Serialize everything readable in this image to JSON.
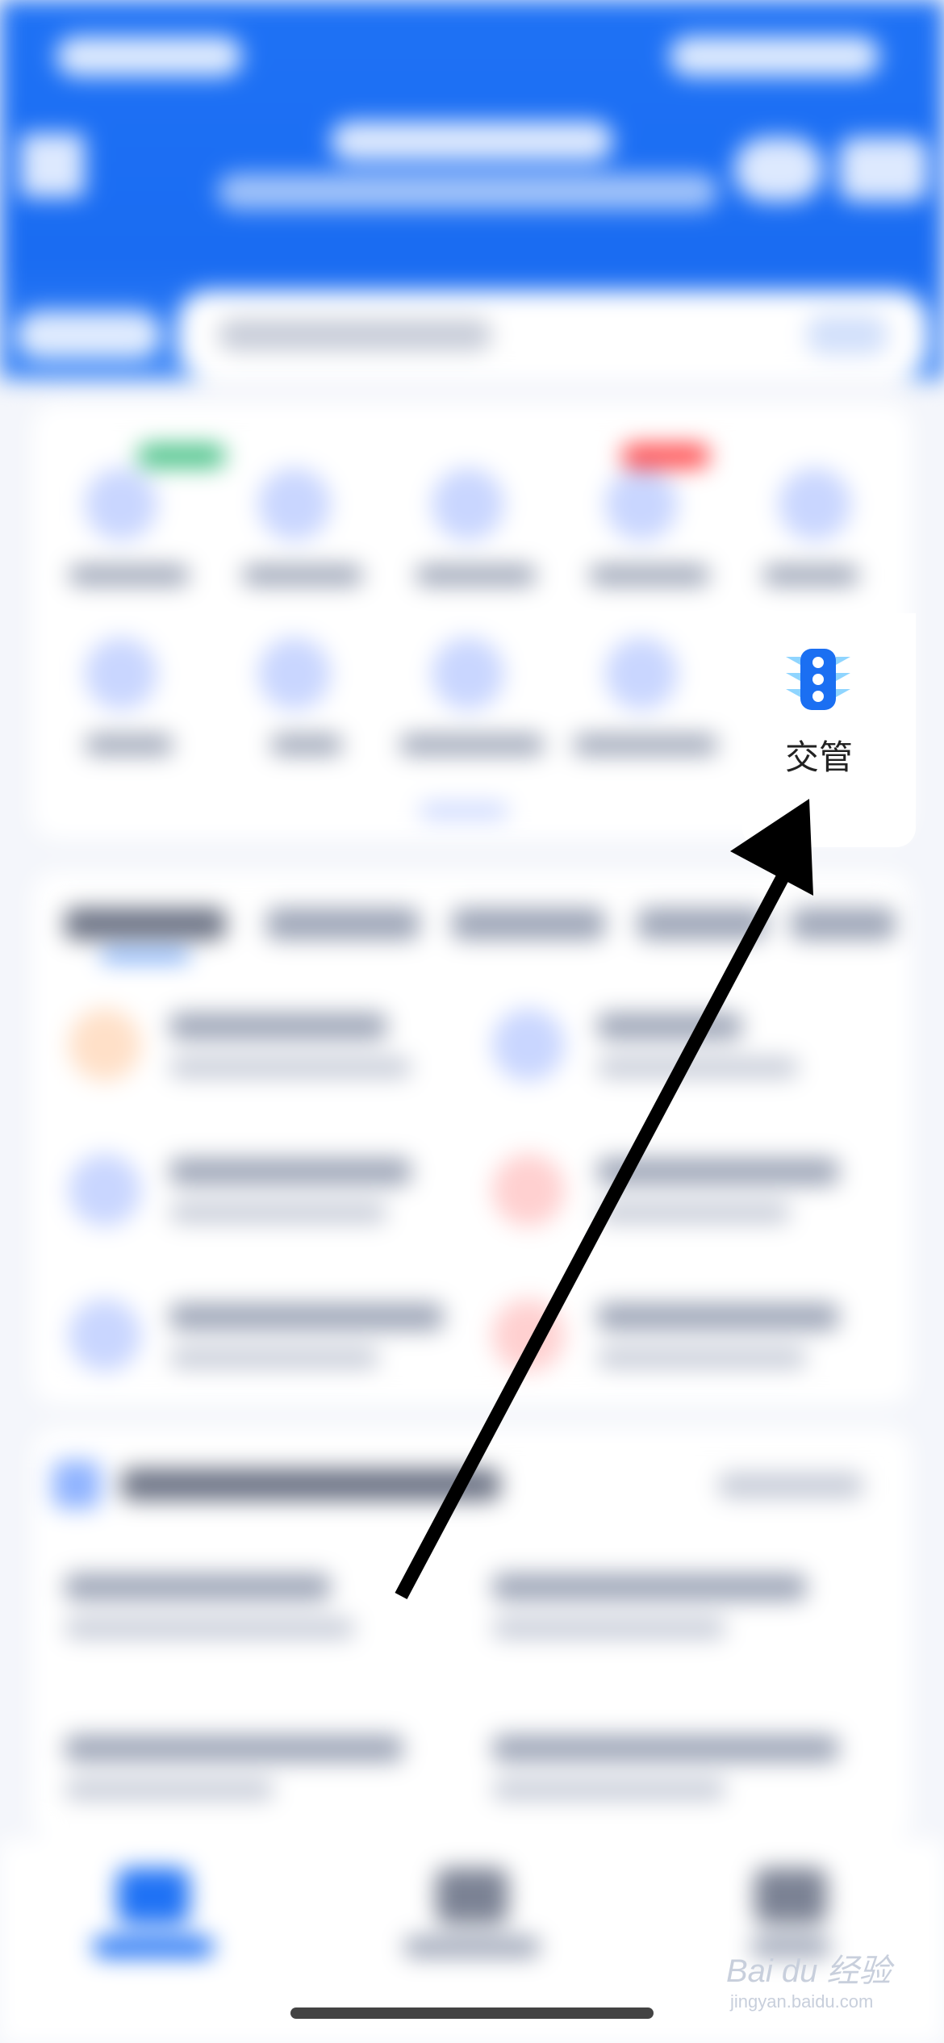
{
  "featured_tile": {
    "label": "交管",
    "icon": "traffic-light-icon",
    "accent": "#1b6ff2",
    "accent_light": "#8fd5ff"
  },
  "annotation": {
    "type": "arrow",
    "color": "#000000"
  },
  "watermark": {
    "text": "Bai du 经验",
    "sub": "jingyan.baidu.com"
  }
}
